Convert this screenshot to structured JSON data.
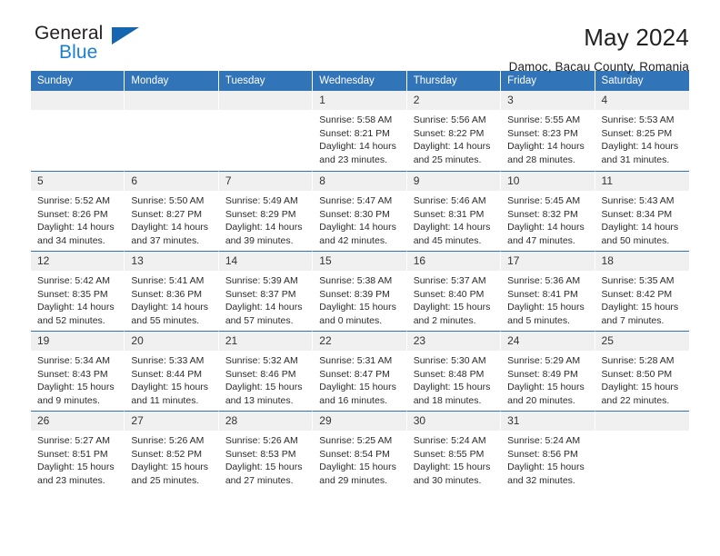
{
  "logo": {
    "word_one": "General",
    "word_two": "Blue",
    "triangle_icon": "blue-triangle-icon",
    "accent_color": "#1a7fd4"
  },
  "header": {
    "title": "May 2024",
    "subtitle": "Damoc, Bacau County, Romania"
  },
  "theme": {
    "header_bar": "#3274b8",
    "daynum_band": "#f0f0f0",
    "text": "#2b2b2b"
  },
  "weekday_headers": [
    "Sunday",
    "Monday",
    "Tuesday",
    "Wednesday",
    "Thursday",
    "Friday",
    "Saturday"
  ],
  "labels": {
    "sunrise": "Sunrise:",
    "sunset": "Sunset:",
    "daylight": "Daylight:"
  },
  "weeks": [
    [
      {
        "day": "",
        "empty": true
      },
      {
        "day": "",
        "empty": true
      },
      {
        "day": "",
        "empty": true
      },
      {
        "day": "1",
        "sunrise": "Sunrise: 5:58 AM",
        "sunset": "Sunset: 8:21 PM",
        "daylight1": "Daylight: 14 hours",
        "daylight2": "and 23 minutes."
      },
      {
        "day": "2",
        "sunrise": "Sunrise: 5:56 AM",
        "sunset": "Sunset: 8:22 PM",
        "daylight1": "Daylight: 14 hours",
        "daylight2": "and 25 minutes."
      },
      {
        "day": "3",
        "sunrise": "Sunrise: 5:55 AM",
        "sunset": "Sunset: 8:23 PM",
        "daylight1": "Daylight: 14 hours",
        "daylight2": "and 28 minutes."
      },
      {
        "day": "4",
        "sunrise": "Sunrise: 5:53 AM",
        "sunset": "Sunset: 8:25 PM",
        "daylight1": "Daylight: 14 hours",
        "daylight2": "and 31 minutes."
      }
    ],
    [
      {
        "day": "5",
        "sunrise": "Sunrise: 5:52 AM",
        "sunset": "Sunset: 8:26 PM",
        "daylight1": "Daylight: 14 hours",
        "daylight2": "and 34 minutes."
      },
      {
        "day": "6",
        "sunrise": "Sunrise: 5:50 AM",
        "sunset": "Sunset: 8:27 PM",
        "daylight1": "Daylight: 14 hours",
        "daylight2": "and 37 minutes."
      },
      {
        "day": "7",
        "sunrise": "Sunrise: 5:49 AM",
        "sunset": "Sunset: 8:29 PM",
        "daylight1": "Daylight: 14 hours",
        "daylight2": "and 39 minutes."
      },
      {
        "day": "8",
        "sunrise": "Sunrise: 5:47 AM",
        "sunset": "Sunset: 8:30 PM",
        "daylight1": "Daylight: 14 hours",
        "daylight2": "and 42 minutes."
      },
      {
        "day": "9",
        "sunrise": "Sunrise: 5:46 AM",
        "sunset": "Sunset: 8:31 PM",
        "daylight1": "Daylight: 14 hours",
        "daylight2": "and 45 minutes."
      },
      {
        "day": "10",
        "sunrise": "Sunrise: 5:45 AM",
        "sunset": "Sunset: 8:32 PM",
        "daylight1": "Daylight: 14 hours",
        "daylight2": "and 47 minutes."
      },
      {
        "day": "11",
        "sunrise": "Sunrise: 5:43 AM",
        "sunset": "Sunset: 8:34 PM",
        "daylight1": "Daylight: 14 hours",
        "daylight2": "and 50 minutes."
      }
    ],
    [
      {
        "day": "12",
        "sunrise": "Sunrise: 5:42 AM",
        "sunset": "Sunset: 8:35 PM",
        "daylight1": "Daylight: 14 hours",
        "daylight2": "and 52 minutes."
      },
      {
        "day": "13",
        "sunrise": "Sunrise: 5:41 AM",
        "sunset": "Sunset: 8:36 PM",
        "daylight1": "Daylight: 14 hours",
        "daylight2": "and 55 minutes."
      },
      {
        "day": "14",
        "sunrise": "Sunrise: 5:39 AM",
        "sunset": "Sunset: 8:37 PM",
        "daylight1": "Daylight: 14 hours",
        "daylight2": "and 57 minutes."
      },
      {
        "day": "15",
        "sunrise": "Sunrise: 5:38 AM",
        "sunset": "Sunset: 8:39 PM",
        "daylight1": "Daylight: 15 hours",
        "daylight2": "and 0 minutes."
      },
      {
        "day": "16",
        "sunrise": "Sunrise: 5:37 AM",
        "sunset": "Sunset: 8:40 PM",
        "daylight1": "Daylight: 15 hours",
        "daylight2": "and 2 minutes."
      },
      {
        "day": "17",
        "sunrise": "Sunrise: 5:36 AM",
        "sunset": "Sunset: 8:41 PM",
        "daylight1": "Daylight: 15 hours",
        "daylight2": "and 5 minutes."
      },
      {
        "day": "18",
        "sunrise": "Sunrise: 5:35 AM",
        "sunset": "Sunset: 8:42 PM",
        "daylight1": "Daylight: 15 hours",
        "daylight2": "and 7 minutes."
      }
    ],
    [
      {
        "day": "19",
        "sunrise": "Sunrise: 5:34 AM",
        "sunset": "Sunset: 8:43 PM",
        "daylight1": "Daylight: 15 hours",
        "daylight2": "and 9 minutes."
      },
      {
        "day": "20",
        "sunrise": "Sunrise: 5:33 AM",
        "sunset": "Sunset: 8:44 PM",
        "daylight1": "Daylight: 15 hours",
        "daylight2": "and 11 minutes."
      },
      {
        "day": "21",
        "sunrise": "Sunrise: 5:32 AM",
        "sunset": "Sunset: 8:46 PM",
        "daylight1": "Daylight: 15 hours",
        "daylight2": "and 13 minutes."
      },
      {
        "day": "22",
        "sunrise": "Sunrise: 5:31 AM",
        "sunset": "Sunset: 8:47 PM",
        "daylight1": "Daylight: 15 hours",
        "daylight2": "and 16 minutes."
      },
      {
        "day": "23",
        "sunrise": "Sunrise: 5:30 AM",
        "sunset": "Sunset: 8:48 PM",
        "daylight1": "Daylight: 15 hours",
        "daylight2": "and 18 minutes."
      },
      {
        "day": "24",
        "sunrise": "Sunrise: 5:29 AM",
        "sunset": "Sunset: 8:49 PM",
        "daylight1": "Daylight: 15 hours",
        "daylight2": "and 20 minutes."
      },
      {
        "day": "25",
        "sunrise": "Sunrise: 5:28 AM",
        "sunset": "Sunset: 8:50 PM",
        "daylight1": "Daylight: 15 hours",
        "daylight2": "and 22 minutes."
      }
    ],
    [
      {
        "day": "26",
        "sunrise": "Sunrise: 5:27 AM",
        "sunset": "Sunset: 8:51 PM",
        "daylight1": "Daylight: 15 hours",
        "daylight2": "and 23 minutes."
      },
      {
        "day": "27",
        "sunrise": "Sunrise: 5:26 AM",
        "sunset": "Sunset: 8:52 PM",
        "daylight1": "Daylight: 15 hours",
        "daylight2": "and 25 minutes."
      },
      {
        "day": "28",
        "sunrise": "Sunrise: 5:26 AM",
        "sunset": "Sunset: 8:53 PM",
        "daylight1": "Daylight: 15 hours",
        "daylight2": "and 27 minutes."
      },
      {
        "day": "29",
        "sunrise": "Sunrise: 5:25 AM",
        "sunset": "Sunset: 8:54 PM",
        "daylight1": "Daylight: 15 hours",
        "daylight2": "and 29 minutes."
      },
      {
        "day": "30",
        "sunrise": "Sunrise: 5:24 AM",
        "sunset": "Sunset: 8:55 PM",
        "daylight1": "Daylight: 15 hours",
        "daylight2": "and 30 minutes."
      },
      {
        "day": "31",
        "sunrise": "Sunrise: 5:24 AM",
        "sunset": "Sunset: 8:56 PM",
        "daylight1": "Daylight: 15 hours",
        "daylight2": "and 32 minutes."
      },
      {
        "day": "",
        "empty": true
      }
    ]
  ]
}
